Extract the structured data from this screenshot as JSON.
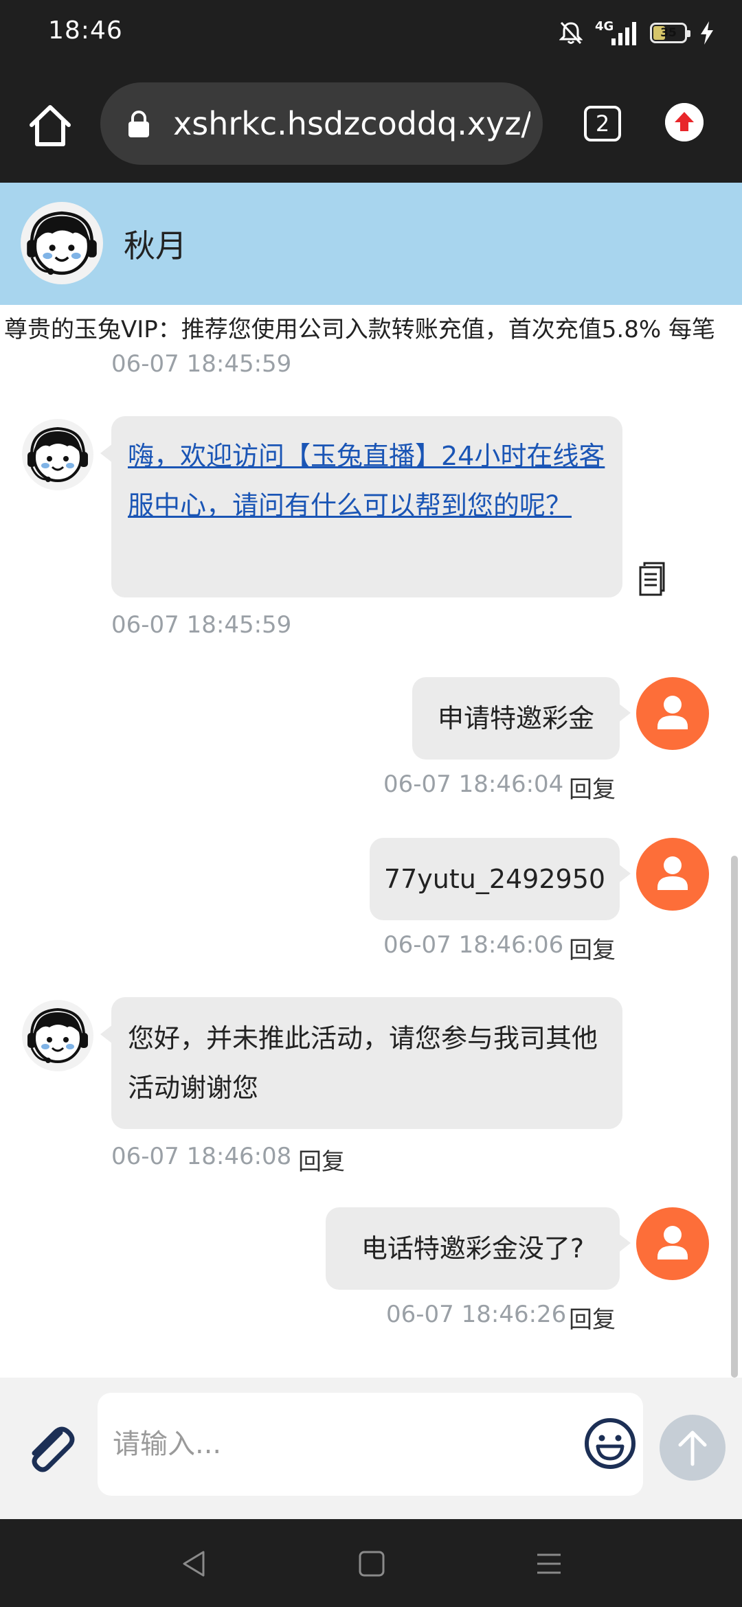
{
  "status_bar": {
    "time": "18:46",
    "network_label": "4G",
    "battery_level": "35",
    "battery_fraction": 0.35
  },
  "browser": {
    "url": "xshrkc.hsdzcoddq.xyz/ir",
    "tab_count": "2"
  },
  "header": {
    "agent_name": "秋月"
  },
  "notice": {
    "text": "尊贵的玉兔VIP：推荐您使用公司入款转账充值，首次充值5.8% 每笔"
  },
  "messages": [
    {
      "sender": "agent",
      "time": "06-07 18:45:59"
    },
    {
      "sender": "agent",
      "text": "嗨，欢迎访问【玉兔直播】24小时在线客服中心，请问有什么可以帮到您的呢？",
      "time": "06-07 18:45:59"
    },
    {
      "sender": "user",
      "text": "申请特邀彩金",
      "time": "06-07 18:46:04",
      "reply": "回复"
    },
    {
      "sender": "user",
      "text": "77yutu_2492950",
      "time": "06-07 18:46:06",
      "reply": "回复"
    },
    {
      "sender": "agent",
      "text": "您好，并未推此活动，请您参与我司其他活动谢谢您",
      "time": "06-07 18:46:08",
      "reply": "回复"
    },
    {
      "sender": "user",
      "text": "电话特邀彩金没了?",
      "time": "06-07 18:46:26",
      "reply": "回复"
    }
  ],
  "input": {
    "placeholder": "请输入...",
    "value": ""
  },
  "icons": {
    "home": "home-icon",
    "lock": "lock-icon",
    "upload": "upload-arrow-icon",
    "copy": "copy-document-icon",
    "attach": "paperclip-icon",
    "emoji": "smiley-icon",
    "send": "send-arrow-icon",
    "nav_back": "back-triangle-icon",
    "nav_home": "square-home-icon",
    "nav_menu": "menu-lines-icon"
  },
  "colors": {
    "header_bg": "#a8d5ee",
    "user_avatar": "#fd6e39",
    "bubble_bg": "#ebebeb",
    "link": "#1a55b5",
    "send_btn": "#c6ced6"
  }
}
